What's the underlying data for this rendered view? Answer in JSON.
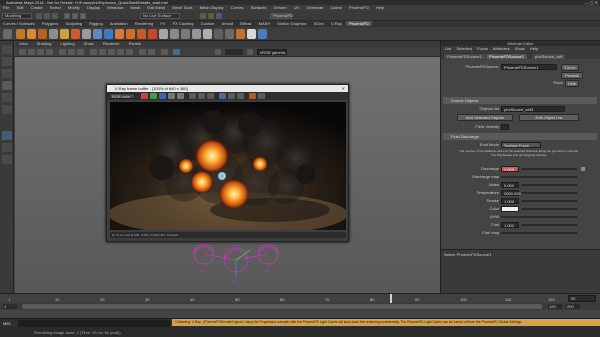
{
  "app": {
    "title": "Autodesk Maya 2018 - Not for Resale: H:\\Examples\\Explosion_QuickStart\\Details_start.mel",
    "window_controls": "—  ▢  ✕"
  },
  "menubar": [
    "File",
    "Edit",
    "Create",
    "Select",
    "Modify",
    "Display",
    "Windows",
    "Mesh",
    "Edit Mesh",
    "Mesh Tools",
    "Mesh Display",
    "Curves",
    "Surfaces",
    "Deform",
    "UV",
    "Generate",
    "Cache",
    "PhoenixFD",
    "Help"
  ],
  "statusline": {
    "mode": "Modeling",
    "no_live": "No Live Surface",
    "phoenix_tab": "PhoenixFD"
  },
  "shelf_tabs": [
    "Curves / Surfaces",
    "Polygons",
    "Sculpting",
    "Rigging",
    "Animation",
    "Rendering",
    "FX",
    "FX Caching",
    "Custom",
    "Arnold",
    "Bifrost",
    "MASH",
    "Motion Graphics",
    "XGen",
    "V-Ray",
    "PhoenixFD"
  ],
  "shelf_active": "PhoenixFD",
  "viewport": {
    "menu": [
      "View",
      "Shading",
      "Lighting",
      "Show",
      "Renderer",
      "Panels"
    ],
    "camera_field": "sRGB gamma"
  },
  "vfb": {
    "title": "V-Ray frame buffer - [100% of 640 x 360]",
    "channel": "RGB color",
    "status": "[0, 0] 1x1 raw [0.000, 0.000, 0.000] HSV, Finished"
  },
  "attribute_editor": {
    "title": "Attribute Editor",
    "menu": [
      "List",
      "Selected",
      "Focus",
      "Attributes",
      "Show",
      "Help"
    ],
    "tabs": [
      "PhoenixFDSource1",
      "PhoenixFDSource2",
      "phxSource_cell"
    ],
    "node_label": "PhoenixFDSource:",
    "node_value": "PhoenixFDSource1",
    "focus_btn": "Focus",
    "presets_btn": "Presets",
    "show_label": "Show",
    "hide_btn": "Hide",
    "section_source_objects": "Source Objects",
    "objects_list_label": "Objects list",
    "objects_list_value": "phxSource_cell1",
    "add_btn": "Add Selected Objects",
    "edit_btn": "Edit Object List",
    "field_vel_label": "Field Velocity",
    "section_fluid": "Fluid Discharge",
    "emit_mode_label": "Emit Mode",
    "emit_mode_value": "Surface Force",
    "help_text": "The number of the additions will emit the selected channels along the geometry's normals. The Discharges acts as Outgoing Velocity.",
    "discharge_label": "Discharge",
    "discharge_value": "1.000",
    "discharge_map_label": "Discharge map",
    "noise_label": "Noise",
    "noise_value": "0.000",
    "temperature_label": "Temperature",
    "temperature_value": "2000.000",
    "smoke_label": "Smoke",
    "smoke_value": "1.000",
    "color_label": "Color",
    "uvw_label": "UVW",
    "fuel_label": "Fuel",
    "fuel_value": "1.000",
    "fuel_map_label": "Fuel map",
    "notes_label": "Notes: PhoenixFDSource1"
  },
  "timeline": {
    "ticks": [
      "1",
      "10",
      "20",
      "30",
      "40",
      "50",
      "60",
      "70",
      "80",
      "90",
      "100",
      "110",
      "120"
    ],
    "current": "90"
  },
  "range": {
    "start": "1",
    "end": "120",
    "anim_end": "200"
  },
  "cmd": {
    "label": "MEL",
    "warning": "// Warning: V-Ray : [PhoenixFDRenderEngine]: Using the Progressive sampler with the PhoenixFD Light Cache will slow down the rendering considerably. The PhoenixFD Light Cache can be turned off from the PhoenixFD Global Settings."
  },
  "help": {
    "label": "Rendering image done: 1 (Time: 0h 1m 5s (real))"
  },
  "colors": {
    "accent_orange": "#d9a04a",
    "fire": "#ff9a2a",
    "rig_magenta": "#c03bb4"
  }
}
